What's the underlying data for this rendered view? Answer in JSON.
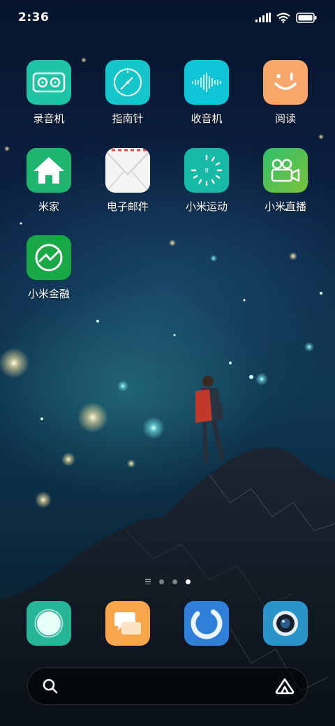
{
  "status_bar": {
    "time": "2:36",
    "icons": [
      "signal-icon",
      "wifi-icon",
      "battery-icon"
    ]
  },
  "apps": [
    {
      "name": "recorder",
      "label": "录音机",
      "icon": "tape-recorder-icon",
      "color": "#1fc3a6"
    },
    {
      "name": "compass",
      "label": "指南针",
      "icon": "compass-icon",
      "color": "#14c6c9"
    },
    {
      "name": "radio",
      "label": "收音机",
      "icon": "soundwave-icon",
      "color": "#10c5d6"
    },
    {
      "name": "reader",
      "label": "阅读",
      "icon": "smiley-icon",
      "color": "#f9a66a"
    },
    {
      "name": "mi-home",
      "label": "米家",
      "icon": "house-icon",
      "color": "#1fb46f"
    },
    {
      "name": "email",
      "label": "电子邮件",
      "icon": "envelope-icon",
      "color": "#f4f4f4"
    },
    {
      "name": "mi-fitness",
      "label": "小米运动",
      "icon": "step-ring-icon",
      "color": "#19b9a8"
    },
    {
      "name": "mi-live",
      "label": "小米直播",
      "icon": "video-camera-icon",
      "color": "#3fc070"
    },
    {
      "name": "mi-finance",
      "label": "小米金融",
      "icon": "trend-circle-icon",
      "color": "#18a846"
    }
  ],
  "page_indicator": {
    "pages": 3,
    "active": 3
  },
  "dock": [
    {
      "name": "phone",
      "icon": "circle-button-icon",
      "color": "#27b598"
    },
    {
      "name": "messages",
      "icon": "chat-bubbles-icon",
      "color": "#f8a64c"
    },
    {
      "name": "browser",
      "icon": "loading-ring-icon",
      "color": "#2f7fd8"
    },
    {
      "name": "camera",
      "icon": "camera-lens-icon",
      "color": "#2a93c7"
    }
  ],
  "search": {
    "placeholder": "",
    "icons": [
      "search-icon",
      "assistant-icon"
    ]
  }
}
